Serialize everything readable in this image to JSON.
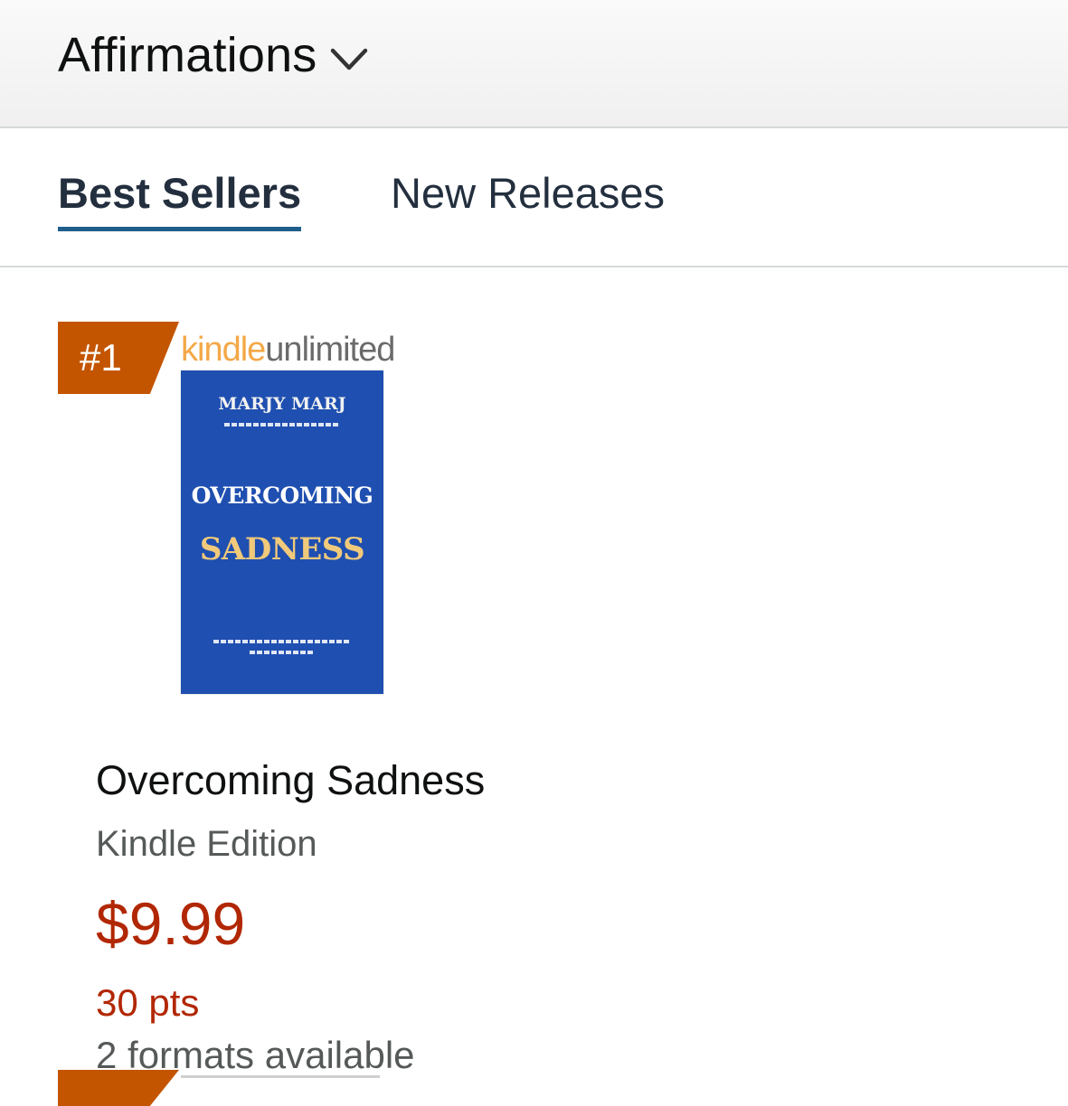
{
  "header": {
    "category_title": "Affirmations",
    "dropdown_icon": "chevron-down-icon"
  },
  "tabs": [
    {
      "label": "Best Sellers",
      "active": true
    },
    {
      "label": "New Releases",
      "active": false
    }
  ],
  "products": [
    {
      "rank": "#1",
      "badge_kindle": "kindle",
      "badge_unlimited": "unlimited",
      "cover": {
        "author": "MARJY MARJ",
        "title_line1": "OVERCOMING",
        "title_line2": "SADNESS"
      },
      "title": "Overcoming Sadness",
      "format": "Kindle Edition",
      "price": "$9.99",
      "points": "30 pts",
      "formats_available": "2 formats available"
    }
  ],
  "colors": {
    "rank_badge": "#c45500",
    "price": "#b12704",
    "tab_underline": "#1f5e8b",
    "cover_background": "#1f4fb0",
    "kindle_orange": "#f3a847"
  }
}
